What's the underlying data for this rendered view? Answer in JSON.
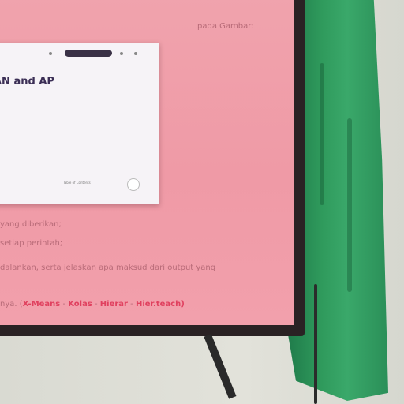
{
  "screen_lines": {
    "top": "pada Gambar:",
    "l1": "yang diberikan;",
    "l2": "setiap perintah;",
    "l3": "dalankan, serta jelaskan apa maksud dari output yang",
    "l4_prefix": "nya. (",
    "l4_kw1": "X-Means",
    "l4_sep1": " - ",
    "l4_kw2": "Kolas",
    "l4_sep2": " - ",
    "l4_kw3": "Hierar",
    "l4_sep3": " - ",
    "l4_kw4": "Hier.teach)"
  },
  "card": {
    "title": "AN and AP",
    "badge": "",
    "meta": "",
    "toc": "Table of Contents",
    "toc_sub": ""
  },
  "colors": {
    "screen_pink": "#ef9aa6",
    "keyword_red": "#e0415f",
    "cloth_green": "#2f9a5c"
  }
}
